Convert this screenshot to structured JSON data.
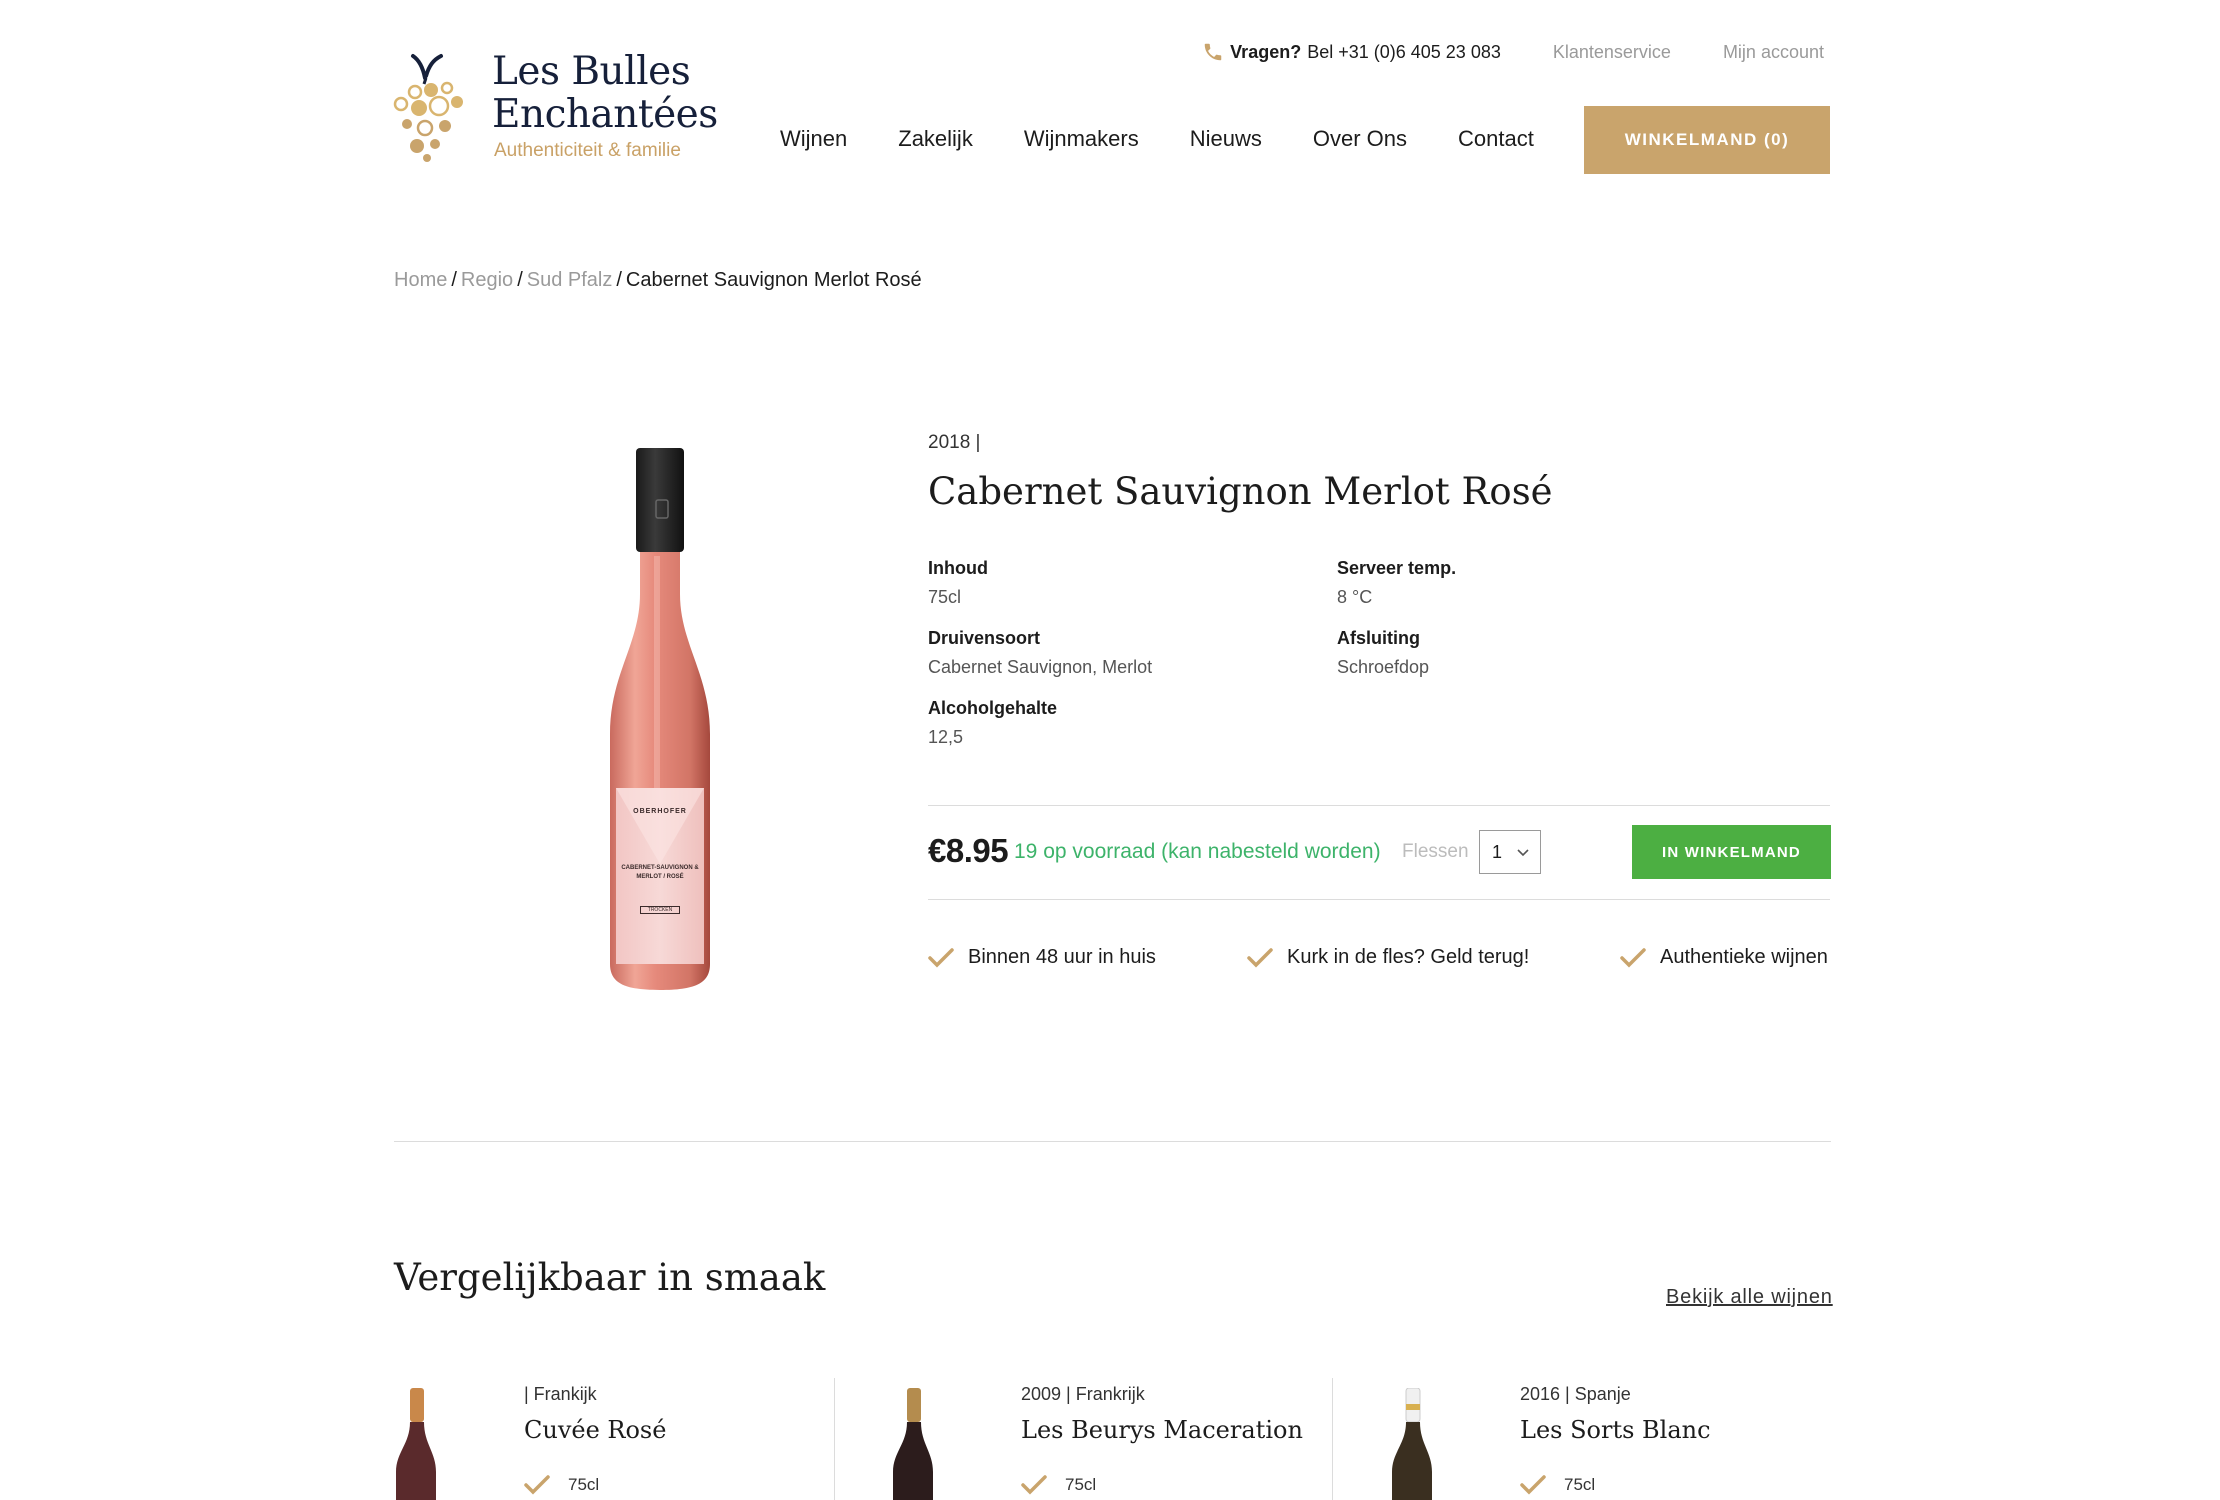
{
  "brand": {
    "name_line1": "Les Bulles",
    "name_line2": "Enchantées",
    "tagline": "Authenticiteit & familie",
    "colors": {
      "gold": "#c9a46c",
      "navy": "#16203a",
      "green": "#4caf42",
      "stock_green": "#3db36a"
    }
  },
  "topbar": {
    "question": "Vragen?",
    "phone": "Bel +31 (0)6 405 23 083",
    "links": [
      "Klantenservice",
      "Mijn account"
    ]
  },
  "nav": {
    "items": [
      "Wijnen",
      "Zakelijk",
      "Wijnmakers",
      "Nieuws",
      "Over Ons",
      "Contact"
    ],
    "cart_label": "WINKELMAND (0)"
  },
  "breadcrumb": {
    "items": [
      "Home",
      "Regio",
      "Sud Pfalz"
    ],
    "current": "Cabernet Sauvignon Merlot Rosé"
  },
  "product": {
    "vintage_line": "2018 |",
    "title": "Cabernet Sauvignon Merlot Rosé",
    "specs": {
      "inhoud": {
        "label": "Inhoud",
        "value": "75cl"
      },
      "druivensoort": {
        "label": "Druivensoort",
        "value": "Cabernet Sauvignon, Merlot"
      },
      "alcohol": {
        "label": "Alcoholgehalte",
        "value": "12,5"
      },
      "temp": {
        "label": "Serveer temp.",
        "value": "8 °C"
      },
      "afsluiting": {
        "label": "Afsluiting",
        "value": "Schroefdop"
      }
    },
    "price": "€8.95",
    "stock": "19 op voorraad (kan nabesteld worden)",
    "unit_label": "Flessen",
    "quantity": "1",
    "add_button": "IN WINKELMAND",
    "label_text": {
      "producer": "OBERHOFER",
      "wine": "CABERNET-SAUVIGNON & MERLOT / ROSÉ",
      "style": "TROCKEN"
    }
  },
  "usps": [
    "Binnen 48 uur in huis",
    "Kurk in de fles? Geld terug!",
    "Authentieke wijnen"
  ],
  "similar": {
    "title": "Vergelijkbaar in smaak",
    "view_all": "Bekijk alle wijnen",
    "items": [
      {
        "meta": "| Frankijk",
        "name": "Cuvée Rosé",
        "volume": "75cl"
      },
      {
        "meta": "2009 | Frankrijk",
        "name": "Les Beurys Maceration",
        "volume": "75cl"
      },
      {
        "meta": "2016 | Spanje",
        "name": "Les Sorts Blanc",
        "volume": "75cl"
      }
    ]
  }
}
